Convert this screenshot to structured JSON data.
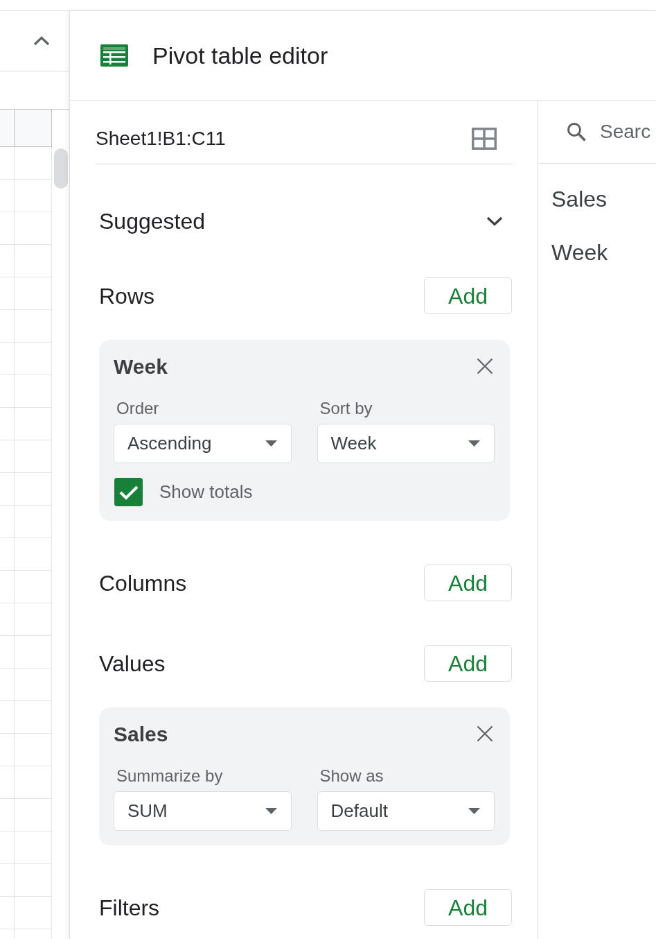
{
  "editor": {
    "title": "Pivot table editor"
  },
  "range": {
    "value": "Sheet1!B1:C11"
  },
  "suggested": {
    "label": "Suggested",
    "expanded": false
  },
  "sections": [
    {
      "label": "Rows",
      "button": "Add",
      "cards": [
        {
          "field": "Week",
          "selects": [
            {
              "label": "Order",
              "value": "Ascending"
            },
            {
              "label": "Sort by",
              "value": "Week"
            }
          ],
          "show_totals": {
            "label": "Show totals",
            "checked": true
          }
        }
      ]
    },
    {
      "label": "Columns",
      "button": "Add"
    },
    {
      "label": "Values",
      "button": "Add",
      "cards": [
        {
          "field": "Sales",
          "selects": [
            {
              "label": "Summarize by",
              "value": "SUM"
            },
            {
              "label": "Show as",
              "value": "Default"
            }
          ]
        }
      ]
    },
    {
      "label": "Filters",
      "button": "Add"
    }
  ],
  "field_list": {
    "search": {
      "placeholder": "Searc"
    },
    "items": [
      "Sales",
      "Week"
    ]
  }
}
